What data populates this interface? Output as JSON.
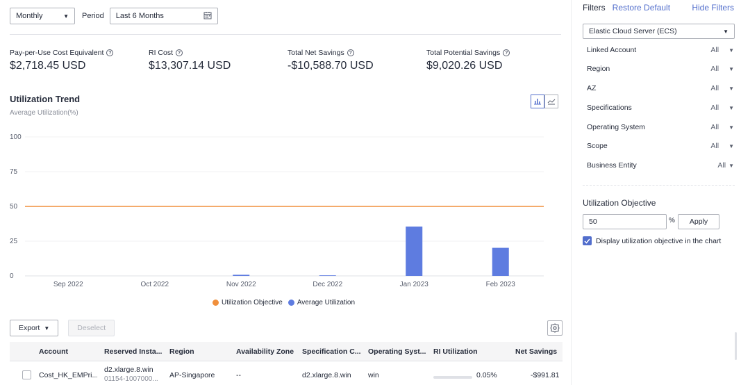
{
  "topbar": {
    "granularity": "Monthly",
    "period_label": "Period",
    "period_value": "Last 6 Months"
  },
  "stats": [
    {
      "label": "Pay-per-Use Cost Equivalent",
      "value": "$2,718.45 USD"
    },
    {
      "label": "RI Cost",
      "value": "$13,307.14 USD"
    },
    {
      "label": "Total Net Savings",
      "value": "-$10,588.70 USD"
    },
    {
      "label": "Total Potential Savings",
      "value": "$9,020.26 USD"
    }
  ],
  "trend": {
    "title": "Utilization Trend",
    "subtitle": "Average Utilization(%)"
  },
  "colors": {
    "objective": "#f08f3c",
    "average": "#5e7ce0",
    "accent": "#526ecc"
  },
  "chart_data": {
    "type": "bar",
    "categories": [
      "Sep 2022",
      "Oct 2022",
      "Nov 2022",
      "Dec 2022",
      "Jan 2023",
      "Feb 2023"
    ],
    "series": [
      {
        "name": "Average Utilization",
        "values": [
          0,
          0,
          0.8,
          0.4,
          35.5,
          20.2
        ]
      }
    ],
    "objective_line": {
      "name": "Utilization Objective",
      "value": 50
    },
    "yticks": [
      0,
      25,
      50,
      75,
      100
    ],
    "ylim": [
      0,
      100
    ],
    "grid": true,
    "legend_placement": "bottom"
  },
  "table": {
    "export_label": "Export",
    "deselect_label": "Deselect",
    "columns": [
      "Account",
      "Reserved Insta...",
      "Region",
      "Availability Zone",
      "Specification C...",
      "Operating Syst...",
      "RI Utilization",
      "Net Savings"
    ],
    "rows": [
      {
        "account": "Cost_HK_EMPri...",
        "reserved_instance": "d2.xlarge.8.win",
        "reserved_instance_id": "01154-1007000...",
        "region": "AP-Singapore",
        "az": "--",
        "spec": "d2.xlarge.8.win",
        "os": "win",
        "utilization": "0.05%",
        "utilization_fraction": 0.0005,
        "net_savings": "-$991.81"
      }
    ]
  },
  "sidebar": {
    "title": "Filters",
    "restore": "Restore Default",
    "hide": "Hide Filters",
    "service": "Elastic Cloud Server (ECS)",
    "filters": [
      {
        "label": "Linked Account",
        "value": "All"
      },
      {
        "label": "Region",
        "value": "All"
      },
      {
        "label": "AZ",
        "value": "All"
      },
      {
        "label": "Specifications",
        "value": "All"
      },
      {
        "label": "Operating System",
        "value": "All"
      },
      {
        "label": "Scope",
        "value": "All"
      },
      {
        "label": "Business Entity",
        "value": "All"
      }
    ],
    "objective_title": "Utilization Objective",
    "objective_value": "50",
    "pct_symbol": "%",
    "apply_label": "Apply",
    "display_checkbox_label": "Display utilization objective in the chart"
  }
}
